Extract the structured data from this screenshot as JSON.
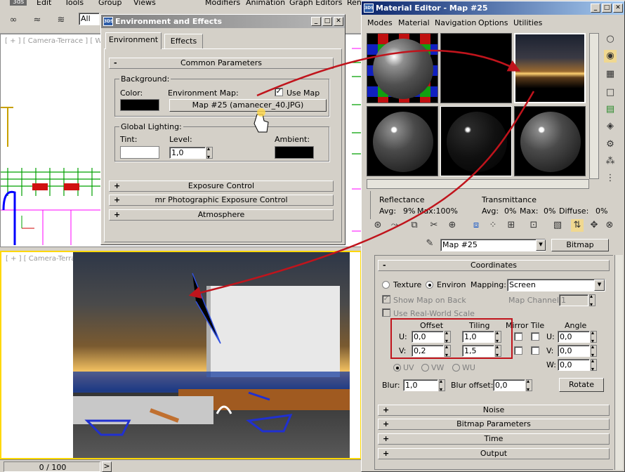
{
  "menubar": {
    "logo": "3ds",
    "items": [
      "Edit",
      "Tools",
      "Group",
      "Views",
      "Modifiers",
      "Animation",
      "Graph Editors",
      "Ren"
    ]
  },
  "toolbar": {
    "selection_filter": "All"
  },
  "viewport_top": {
    "label": "[ + ] [ Camera-Terrace ] [ W"
  },
  "viewport_bottom": {
    "label": "[ + ] [ Camera-Terrace ] [ Realistic ]"
  },
  "timeline": {
    "frame": "0 / 100",
    "next": ">"
  },
  "env_dialog": {
    "title": "Environment and Effects",
    "tabs": [
      "Environment",
      "Effects"
    ],
    "common": {
      "title": "Common Parameters",
      "background_label": "Background:",
      "color_label": "Color:",
      "env_map_label": "Environment Map:",
      "use_map_label": "Use Map",
      "map_button": "Map #25 (amanecer_40.JPG)",
      "global_lighting_label": "Global Lighting:",
      "tint_label": "Tint:",
      "level_label": "Level:",
      "level_value": "1,0",
      "ambient_label": "Ambient:"
    },
    "rollouts": [
      "Exposure Control",
      "mr Photographic Exposure Control",
      "Atmosphere"
    ]
  },
  "mat_editor": {
    "title": "Material Editor - Map #25",
    "menu": [
      "Modes",
      "Material",
      "Navigation",
      "Options",
      "Utilities"
    ],
    "reflectance": {
      "label": "Reflectance",
      "avg": "Avg:",
      "avg_value": "9%",
      "max": "Max:100%"
    },
    "transmittance": {
      "label": "Transmittance",
      "avg": "Avg:",
      "avg_value": "0%",
      "max": "Max:",
      "max_value": "0%",
      "diffuse": "Diffuse:",
      "diffuse_value": "0%"
    },
    "map_name": "Map #25",
    "map_type": "Bitmap",
    "coordinates": {
      "title": "Coordinates",
      "texture": "Texture",
      "environ": "Environ",
      "mapping_label": "Mapping:",
      "mapping_value": "Screen",
      "show_map": "Show Map on Back",
      "map_channel_label": "Map Channel:",
      "map_channel_value": "1",
      "real_world": "Use Real-World Scale",
      "offset_label": "Offset",
      "tiling_label": "Tiling",
      "mirror_tile_label": "Mirror Tile",
      "angle_label": "Angle",
      "u_label": "U:",
      "v_label": "V:",
      "w_label": "W:",
      "offset_u": "0,0",
      "offset_v": "0,2",
      "tiling_u": "1,0",
      "tiling_v": "1,5",
      "angle_u": "0,0",
      "angle_v": "0,0",
      "angle_w": "0,0",
      "uv": "UV",
      "vw": "VW",
      "wu": "WU",
      "blur_label": "Blur:",
      "blur_value": "1,0",
      "blur_offset_label": "Blur offset:",
      "blur_offset_value": "0,0",
      "rotate": "Rotate"
    },
    "rollouts": [
      "Noise",
      "Bitmap Parameters",
      "Time",
      "Output"
    ]
  },
  "colors": {
    "annotation_red": "#c0141c",
    "title_active": "#0a246a",
    "title_inactive": "#808080"
  }
}
